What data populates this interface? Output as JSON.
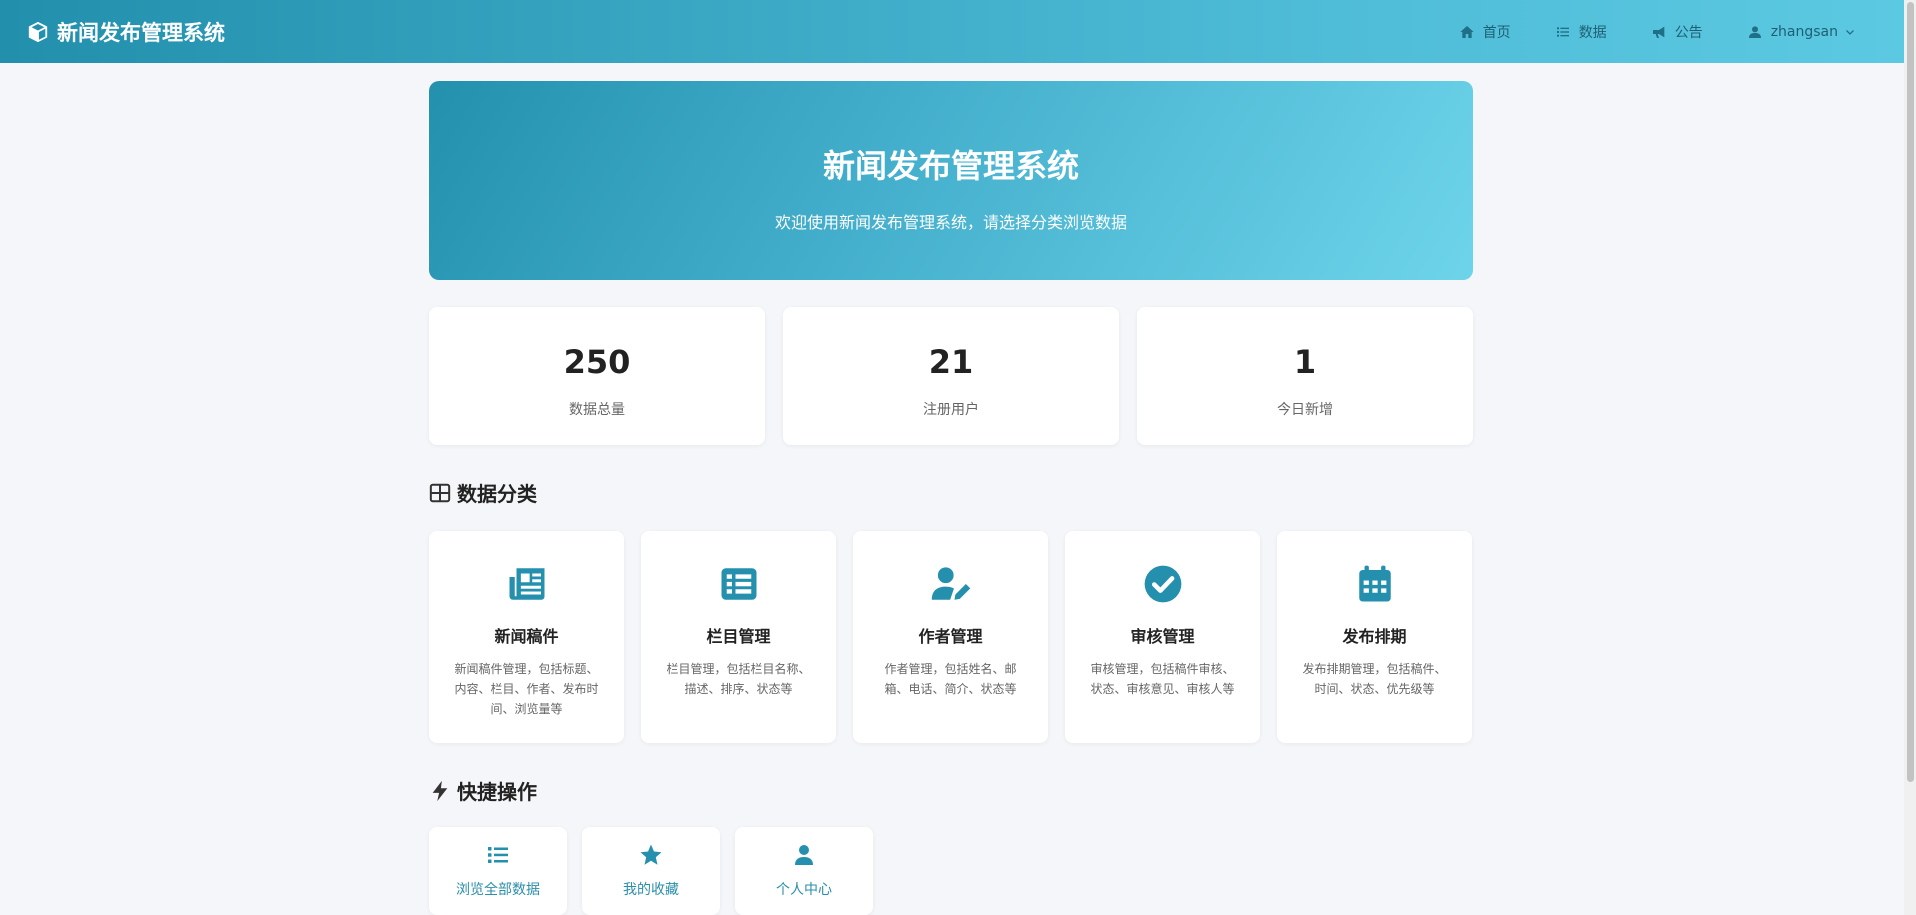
{
  "colors": {
    "accent": "#2590ad",
    "nav_text": "#1f5f73"
  },
  "header": {
    "brand": "新闻发布管理系统",
    "brand_icon": "cube-icon",
    "nav": [
      {
        "label": "首页",
        "icon": "home-icon"
      },
      {
        "label": "数据",
        "icon": "list-icon"
      },
      {
        "label": "公告",
        "icon": "megaphone-icon"
      }
    ],
    "user": {
      "name": "zhangsan",
      "icon": "user-icon"
    }
  },
  "hero": {
    "title": "新闻发布管理系统",
    "subtitle": "欢迎使用新闻发布管理系统，请选择分类浏览数据"
  },
  "stats": [
    {
      "value": "250",
      "label": "数据总量"
    },
    {
      "value": "21",
      "label": "注册用户"
    },
    {
      "value": "1",
      "label": "今日新增"
    }
  ],
  "categories_section": {
    "title": "数据分类",
    "icon": "table-icon"
  },
  "categories": [
    {
      "title": "新闻稿件",
      "desc": "新闻稿件管理，包括标题、内容、栏目、作者、发布时间、浏览量等",
      "icon": "newspaper-icon"
    },
    {
      "title": "栏目管理",
      "desc": "栏目管理，包括栏目名称、描述、排序、状态等",
      "icon": "list-alt-icon"
    },
    {
      "title": "作者管理",
      "desc": "作者管理，包括姓名、邮箱、电话、简介、状态等",
      "icon": "user-edit-icon"
    },
    {
      "title": "审核管理",
      "desc": "审核管理，包括稿件审核、状态、审核意见、审核人等",
      "icon": "check-circle-icon"
    },
    {
      "title": "发布排期",
      "desc": "发布排期管理，包括稿件、时间、状态、优先级等",
      "icon": "calendar-icon"
    }
  ],
  "quick_section": {
    "title": "快捷操作",
    "icon": "bolt-icon"
  },
  "quick_actions": [
    {
      "label": "浏览全部数据",
      "icon": "list-icon"
    },
    {
      "label": "我的收藏",
      "icon": "star-icon"
    },
    {
      "label": "个人中心",
      "icon": "user-icon"
    }
  ]
}
